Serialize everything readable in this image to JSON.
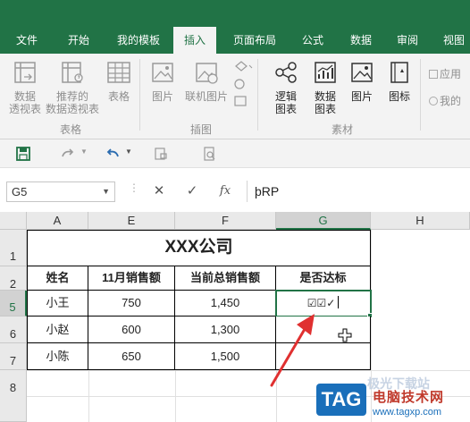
{
  "tabs": [
    {
      "label": "文件",
      "active": false
    },
    {
      "label": "开始",
      "active": false
    },
    {
      "label": "我的模板",
      "active": false
    },
    {
      "label": "插入",
      "active": true
    },
    {
      "label": "页面布局",
      "active": false
    },
    {
      "label": "公式",
      "active": false
    },
    {
      "label": "数据",
      "active": false
    },
    {
      "label": "审阅",
      "active": false
    },
    {
      "label": "视图",
      "active": false
    }
  ],
  "ribbon": {
    "buttons": [
      {
        "label": "数据\n透视表",
        "icon": "pivot-table-icon"
      },
      {
        "label": "推荐的\n数据透视表",
        "icon": "recommended-pivot-icon"
      },
      {
        "label": "表格",
        "icon": "table-icon"
      },
      {
        "label": "图片",
        "icon": "picture-icon"
      },
      {
        "label": "联机图片",
        "icon": "online-picture-icon"
      },
      {
        "label": "逻辑\n图表",
        "icon": "logic-chart-icon"
      },
      {
        "label": "数据\n图表",
        "icon": "data-chart-icon"
      },
      {
        "label": "图片",
        "icon": "picture-icon"
      },
      {
        "label": "图标",
        "icon": "icon-icon"
      }
    ],
    "small": [
      "应用",
      "我的"
    ],
    "groups": [
      "表格",
      "插图",
      "素材"
    ]
  },
  "qat": [
    "save-icon",
    "redo-icon",
    "undo-icon",
    "dropdown-icon",
    "print-preview-icon",
    "print-icon"
  ],
  "formula_bar": {
    "name_box": "G5",
    "cancel": "✕",
    "enter": "✓",
    "fx": "fx",
    "value": "þRP"
  },
  "columns": [
    "A",
    "E",
    "F",
    "G",
    "H"
  ],
  "rows": [
    "1",
    "2",
    "5",
    "6",
    "7",
    "8"
  ],
  "sheet": {
    "title": "XXX公司",
    "headers": [
      "姓名",
      "11月销售额",
      "当前总销售额",
      "是否达标"
    ],
    "rows": [
      {
        "name": "小王",
        "nov": "750",
        "total": "1,450",
        "flag": "☑☑✓"
      },
      {
        "name": "小赵",
        "nov": "600",
        "total": "1,300",
        "flag": ""
      },
      {
        "name": "小陈",
        "nov": "650",
        "total": "1,500",
        "flag": ""
      }
    ]
  },
  "colors": {
    "accent": "#217346",
    "arrow": "#e03030",
    "tag": "#1a6fba"
  },
  "watermark": {
    "badge": "TAG",
    "text": "电脑技术网",
    "url": "www.tagxp.com",
    "partial": "极光下载站"
  }
}
